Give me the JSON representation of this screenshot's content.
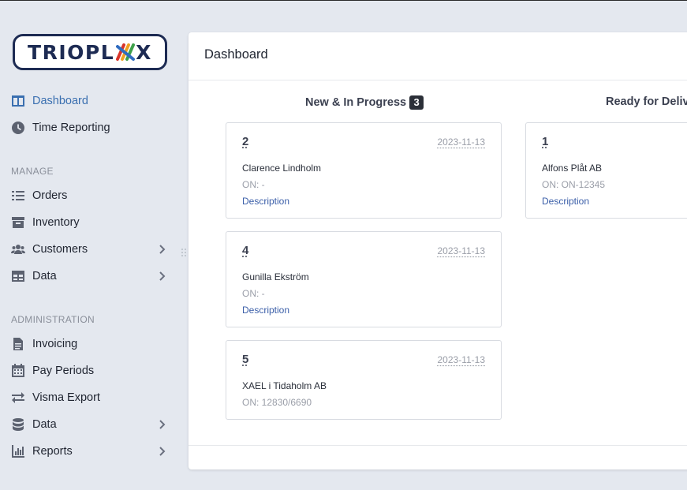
{
  "logo": {
    "text_part": "TRIOPL",
    "text_end": "X"
  },
  "nav": {
    "dashboard": "Dashboard",
    "time_reporting": "Time Reporting",
    "manage_label": "MANAGE",
    "orders": "Orders",
    "inventory": "Inventory",
    "customers": "Customers",
    "data_manage": "Data",
    "administration_label": "ADMINISTRATION",
    "invoicing": "Invoicing",
    "pay_periods": "Pay Periods",
    "visma_export": "Visma Export",
    "data_admin": "Data",
    "reports": "Reports"
  },
  "icons": {
    "dashboard": "columns-icon",
    "time_reporting": "clock-icon",
    "orders": "list-icon",
    "inventory": "archive-icon",
    "customers": "users-icon",
    "data_manage": "table-icon",
    "invoicing": "file-text-icon",
    "pay_periods": "calendar-icon",
    "visma_export": "exchange-icon",
    "data_admin": "database-icon",
    "reports": "bar-chart-icon"
  },
  "main": {
    "title": "Dashboard",
    "columns": [
      {
        "title": "New & In Progress",
        "count": "3",
        "cards": [
          {
            "number": "2",
            "date": "2023-11-13",
            "customer": "Clarence Lindholm",
            "on": "ON: -",
            "description": "Description"
          },
          {
            "number": "4",
            "date": "2023-11-13",
            "customer": "Gunilla Ekström",
            "on": "ON: -",
            "description": "Description"
          },
          {
            "number": "5",
            "date": "2023-11-13",
            "customer": "XAEL i Tidaholm AB",
            "on": "ON: 12830/6690"
          }
        ]
      },
      {
        "title": "Ready for Deliv",
        "cards": [
          {
            "number": "1",
            "customer": "Alfons Plåt AB",
            "on": "ON: ON-12345",
            "description": "Description"
          }
        ]
      }
    ]
  },
  "colors": {
    "background": "#e4e8ef",
    "accent": "#3a6fb0",
    "brand": "#1d2b53",
    "link": "#3a5ea8"
  }
}
